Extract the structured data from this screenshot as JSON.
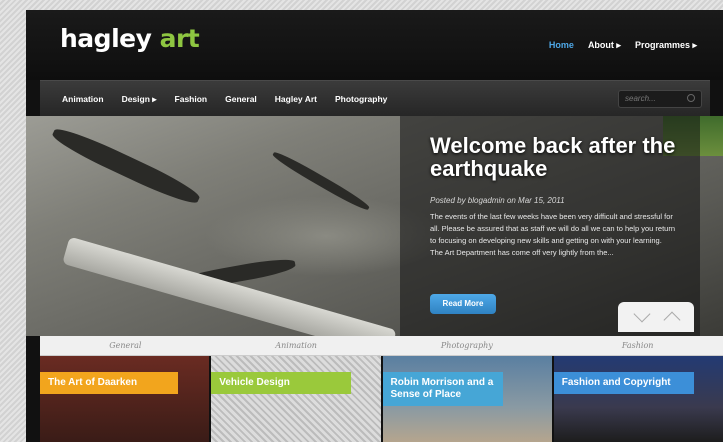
{
  "header": {
    "logo_main": "hagley",
    "logo_accent": "art",
    "nav": [
      "Home",
      "About ▸",
      "Programmes ▸"
    ]
  },
  "categories": [
    "Animation",
    "Design ▸",
    "Fashion",
    "General",
    "Hagley Art",
    "Photography"
  ],
  "search": {
    "placeholder": "search..."
  },
  "hero": {
    "title": "Welcome back after the earthquake",
    "meta": "Posted by blogadmin on Mar 15, 2011",
    "excerpt": "The events of the last few weeks have been very difficult and stressful for all. Please be assured that as staff we will do all we can to help you return to focusing on developing new skills and getting on with your learning. The Art Department has come off very lightly from the...",
    "button": "Read More"
  },
  "tabs": [
    "General",
    "Animation",
    "Photography",
    "Fashion"
  ],
  "cards": [
    {
      "title": "The Art of Daarken",
      "color": "#f2a51d"
    },
    {
      "title": "Vehicle Design",
      "color": "#9ac93b"
    },
    {
      "title": "Robin Morrison and a Sense of Place",
      "color": "#46a6d6"
    },
    {
      "title": "Fashion and Copyright",
      "color": "#3c8fd8"
    }
  ]
}
